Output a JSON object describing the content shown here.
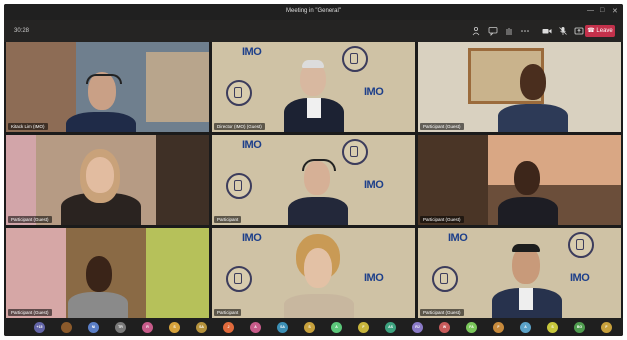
{
  "window": {
    "title": "Meeting in \"General\"",
    "controls": [
      "—",
      "□",
      "✕"
    ]
  },
  "toolbar": {
    "timer": "30:28",
    "leave_label": "Leave",
    "icons": [
      "people-icon",
      "chat-icon",
      "raise-hand-icon",
      "more-icon",
      "camera-icon",
      "mic-icon",
      "share-icon"
    ]
  },
  "tiles": [
    {
      "name": "Kitack Lim (IMO)",
      "bg": "#6f7f8e"
    },
    {
      "name": "Director (IMO) (Guest)",
      "bg": "#cdbf9f"
    },
    {
      "name": "Participant (Guest)",
      "bg": "#d9d1c0"
    },
    {
      "name": "Participant (Guest)",
      "bg": "#b69b84"
    },
    {
      "name": "Participant",
      "bg": "#cdbf9f"
    },
    {
      "name": "Participant (Guest)",
      "bg": "#6b4e3a"
    },
    {
      "name": "Participant (Guest)",
      "bg": "#8a6a45"
    },
    {
      "name": "Participant",
      "bg": "#cdbf9f"
    },
    {
      "name": "Participant (Guest)",
      "bg": "#cdbf9f"
    }
  ],
  "avatars": [
    {
      "initials": "+15",
      "color": "#6264a7"
    },
    {
      "initials": "",
      "color": "#8b5a2b"
    },
    {
      "initials": "NI",
      "color": "#5b7fc7"
    },
    {
      "initials": "TR",
      "color": "#7a7a7a"
    },
    {
      "initials": "R",
      "color": "#c75b8a"
    },
    {
      "initials": "S",
      "color": "#d6a23c"
    },
    {
      "initials": "SA",
      "color": "#b5923c"
    },
    {
      "initials": "J",
      "color": "#e06a3c"
    },
    {
      "initials": "A",
      "color": "#c75b8a"
    },
    {
      "initials": "SA",
      "color": "#3c8fb5"
    },
    {
      "initials": "S",
      "color": "#c7a13c"
    },
    {
      "initials": "A",
      "color": "#5bc77a"
    },
    {
      "initials": "F",
      "color": "#c7b53c"
    },
    {
      "initials": "AS",
      "color": "#3ca27f"
    },
    {
      "initials": "RJ",
      "color": "#8a7ac7"
    },
    {
      "initials": "W",
      "color": "#c75b5b"
    },
    {
      "initials": "FA",
      "color": "#7ac75b"
    },
    {
      "initials": "F",
      "color": "#c78a3c"
    },
    {
      "initials": "A",
      "color": "#5ba2c7"
    },
    {
      "initials": "S",
      "color": "#c7c73c"
    },
    {
      "initials": "BG",
      "color": "#4f9c4f"
    },
    {
      "initials": "F",
      "color": "#c7a03c"
    }
  ]
}
